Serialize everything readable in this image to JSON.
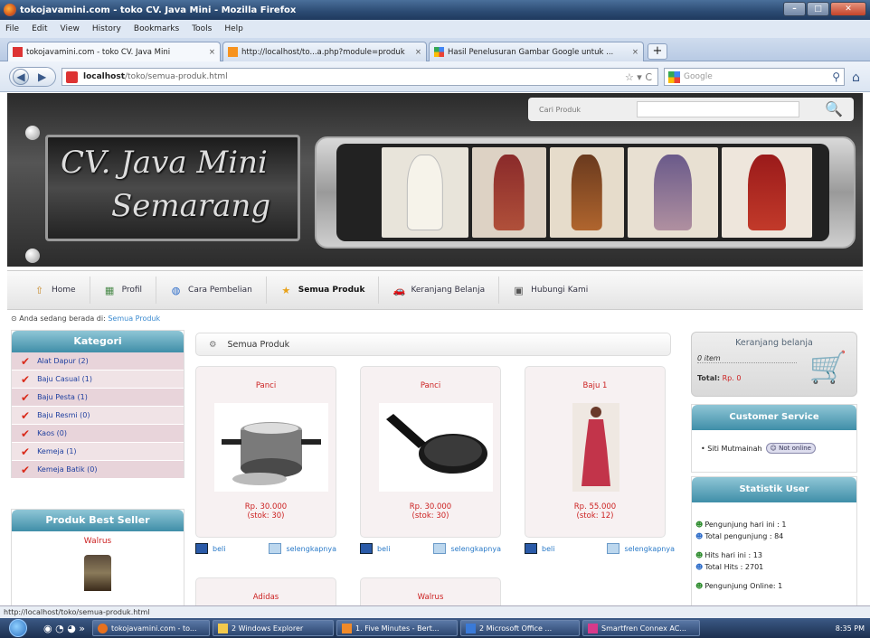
{
  "window": {
    "title": "tokojavamini.com - toko CV. Java Mini - Mozilla Firefox"
  },
  "menu": [
    "File",
    "Edit",
    "View",
    "History",
    "Bookmarks",
    "Tools",
    "Help"
  ],
  "tabs": [
    {
      "label": "tokojavamini.com - toko CV. Java Mini",
      "active": true
    },
    {
      "label": "http://localhost/to...a.php?module=produk",
      "active": false
    },
    {
      "label": "Hasil Penelusuran Gambar Google untuk ...",
      "active": false
    }
  ],
  "address": {
    "host": "localhost",
    "path": "/toko/semua-produk.html"
  },
  "browser_search": {
    "placeholder": "Google"
  },
  "header": {
    "search_placeholder": "Cari Produk",
    "logo_line1": "CV. Java Mini",
    "logo_line2": "Semarang"
  },
  "nav": [
    {
      "label": "Home",
      "icon": "home-icon"
    },
    {
      "label": "Profil",
      "icon": "profile-icon"
    },
    {
      "label": "Cara Pembelian",
      "icon": "globe-icon"
    },
    {
      "label": "Semua Produk",
      "icon": "star-icon"
    },
    {
      "label": "Keranjang Belanja",
      "icon": "car-icon"
    },
    {
      "label": "Hubungi Kami",
      "icon": "contact-icon"
    }
  ],
  "breadcrumb": {
    "prefix": "Anda sedang berada di:",
    "current": "Semua Produk"
  },
  "kategori": {
    "title": "Kategori",
    "items": [
      "Alat Dapur (2)",
      "Baju Casual (1)",
      "Baju Pesta (1)",
      "Baju Resmi (0)",
      "Kaos (0)",
      "Kemeja (1)",
      "Kemeja Batik (0)"
    ]
  },
  "best_seller": {
    "title": "Produk Best Seller",
    "item": "Walrus"
  },
  "main": {
    "title": "Semua Produk"
  },
  "products": [
    {
      "name": "Panci",
      "price": "Rp. 30.000",
      "stock": "(stok: 30)"
    },
    {
      "name": "Panci",
      "price": "Rp. 30.000",
      "stock": "(stok: 30)"
    },
    {
      "name": "Baju 1",
      "price": "Rp. 55.000",
      "stock": "(stok: 12)"
    },
    {
      "name": "Adidas"
    },
    {
      "name": "Walrus"
    }
  ],
  "card_actions": {
    "buy": "beli",
    "detail": "selengkapnya"
  },
  "cart": {
    "title": "Keranjang belanja",
    "items": "0 item",
    "total_label": "Total:",
    "total_value": "Rp. 0"
  },
  "customer_service": {
    "title": "Customer Service",
    "agent": "Siti Mutmainah",
    "status": "Not online"
  },
  "stats": {
    "title": "Statistik User",
    "lines": [
      "Pengunjung hari ini : 1",
      "Total pengunjung : 84",
      "Hits hari ini : 13",
      "Total Hits : 2701",
      "Pengunjung Online: 1"
    ]
  },
  "statusbar": {
    "text": "http://localhost/toko/semua-produk.html"
  },
  "taskbar": {
    "items": [
      "tokojavamini.com - to...",
      "2 Windows Explorer",
      "1. Five Minutes - Bert...",
      "2 Microsoft Office ...",
      "Smartfren Connex AC..."
    ],
    "clock": "8:35 PM"
  }
}
